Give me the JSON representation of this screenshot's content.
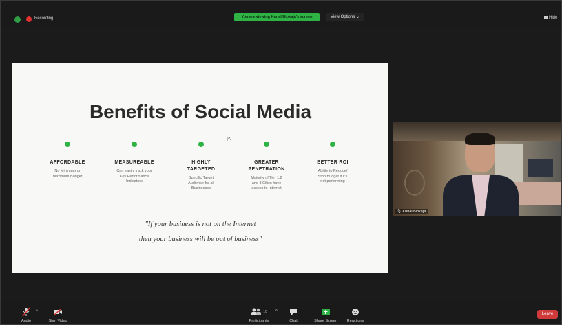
{
  "top_bar": {
    "recording_label": "Recording",
    "share_banner": "You are viewing Kunal Biokaja's screen",
    "view_options": "View Options ⌄",
    "hide_label": "Hide"
  },
  "slide": {
    "title": "Benefits of Social Media",
    "benefits": [
      {
        "title": "AFFORDABLE",
        "desc": "No Minimum or\nMaximum Budget"
      },
      {
        "title": "MEASUREABLE",
        "desc": "Can easily track your\nKey Performance\nIndicators"
      },
      {
        "title": "HIGHLY\nTARGETED",
        "desc": "Specific Target\nAudience for all\nBusinesses"
      },
      {
        "title": "GREATER\nPENETRATION",
        "desc": "Majority of Tier 1,2\nand 3 Cities have\naccess to Internet"
      },
      {
        "title": "BETTER ROI",
        "desc": "Ability to Reduce/\nStop Budget if it's\nnot performing"
      }
    ],
    "quote_line1": "\"If your business is not on the Internet",
    "quote_line2": "then your business will be out of business\""
  },
  "video": {
    "participant_name": "Kunal Biokaja"
  },
  "toolbar": {
    "audio": "Audio",
    "start_video": "Start Video",
    "participants": "Participants",
    "participants_count": "10",
    "chat": "Chat",
    "share_screen": "Share Screen",
    "reactions": "Reactions",
    "leave": "Leave"
  },
  "colors": {
    "accent_green": "#2fb344",
    "leave_red": "#d03a3a",
    "recording_red": "#e03131"
  }
}
